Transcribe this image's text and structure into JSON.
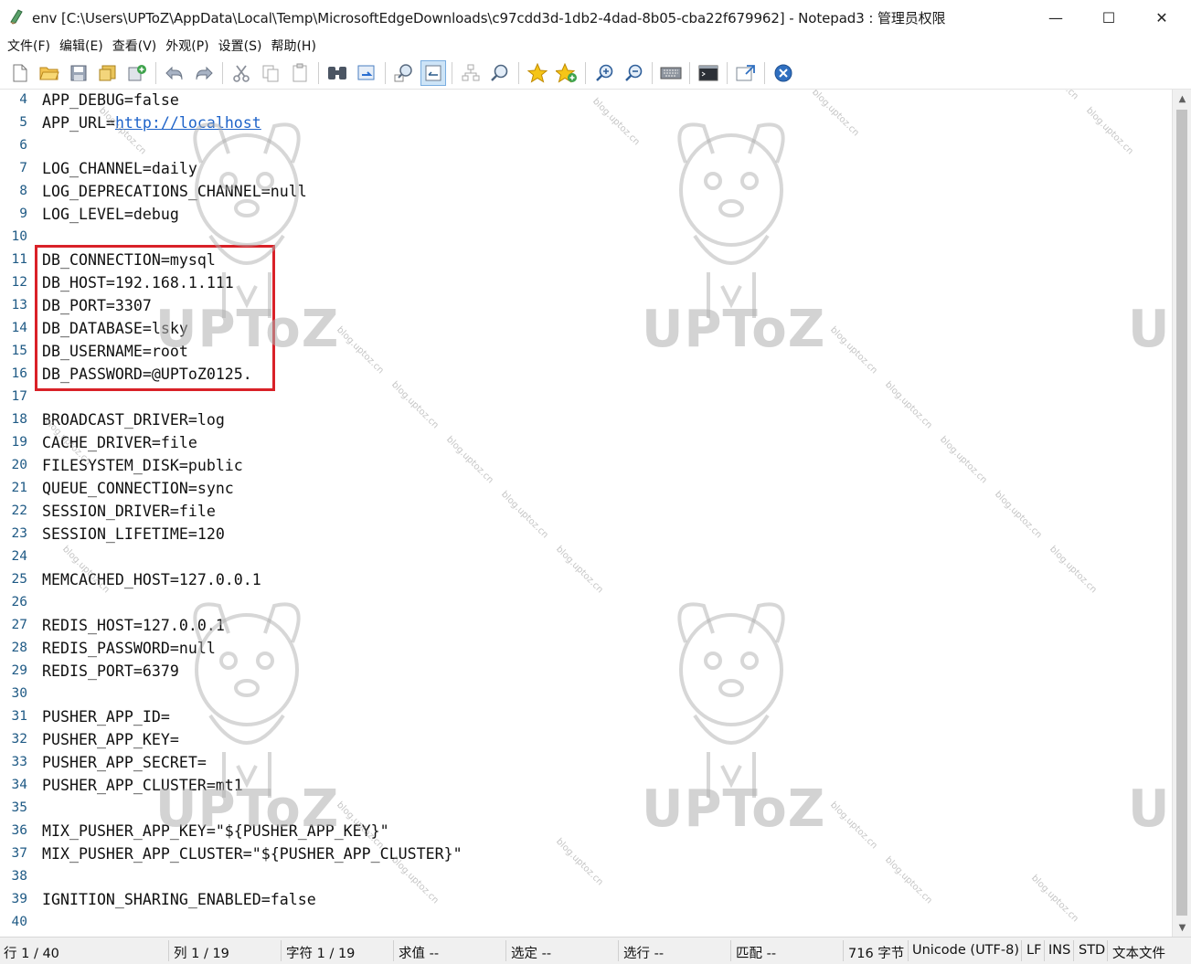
{
  "window": {
    "title": "env [C:\\Users\\UPToZ\\AppData\\Local\\Temp\\MicrosoftEdgeDownloads\\c97cdd3d-1db2-4dad-8b05-cba22f679962] - Notepad3 : 管理员权限",
    "minimize_glyph": "—",
    "maximize_glyph": "☐",
    "close_glyph": "✕"
  },
  "menu": [
    "文件(F)",
    "编辑(E)",
    "查看(V)",
    "外观(P)",
    "设置(S)",
    "帮助(H)"
  ],
  "toolbar": {
    "icons": [
      "new-file-icon",
      "open-folder-icon",
      "save-icon",
      "save-as-icon",
      "save-copy-icon",
      "sep",
      "undo-icon",
      "redo-icon",
      "sep",
      "cut-icon",
      "copy-icon",
      "paste-icon",
      "sep",
      "find-icon",
      "replace-icon",
      "sep",
      "zoom-find-icon",
      "word-wrap-icon",
      "sep",
      "tree-icon",
      "search-icon",
      "sep",
      "favorite-icon",
      "add-favorite-icon",
      "sep",
      "zoom-in-icon",
      "zoom-out-icon",
      "sep",
      "keyboard-icon",
      "sep",
      "terminal-icon",
      "sep",
      "pin-icon",
      "sep",
      "close-circle-icon"
    ]
  },
  "editor": {
    "lines": [
      {
        "n": "4",
        "text": "APP_DEBUG=false"
      },
      {
        "n": "5",
        "text": "APP_URL=",
        "url": "http://localhost"
      },
      {
        "n": "6",
        "text": ""
      },
      {
        "n": "7",
        "text": "LOG_CHANNEL=daily"
      },
      {
        "n": "8",
        "text": "LOG_DEPRECATIONS_CHANNEL=null"
      },
      {
        "n": "9",
        "text": "LOG_LEVEL=debug"
      },
      {
        "n": "10",
        "text": ""
      },
      {
        "n": "11",
        "text": "DB_CONNECTION=mysql"
      },
      {
        "n": "12",
        "text": "DB_HOST=192.168.1.111"
      },
      {
        "n": "13",
        "text": "DB_PORT=3307"
      },
      {
        "n": "14",
        "text": "DB_DATABASE=lsky"
      },
      {
        "n": "15",
        "text": "DB_USERNAME=root"
      },
      {
        "n": "16",
        "text": "DB_PASSWORD=@UPToZ0125."
      },
      {
        "n": "17",
        "text": ""
      },
      {
        "n": "18",
        "text": "BROADCAST_DRIVER=log"
      },
      {
        "n": "19",
        "text": "CACHE_DRIVER=file"
      },
      {
        "n": "20",
        "text": "FILESYSTEM_DISK=public"
      },
      {
        "n": "21",
        "text": "QUEUE_CONNECTION=sync"
      },
      {
        "n": "22",
        "text": "SESSION_DRIVER=file"
      },
      {
        "n": "23",
        "text": "SESSION_LIFETIME=120"
      },
      {
        "n": "24",
        "text": ""
      },
      {
        "n": "25",
        "text": "MEMCACHED_HOST=127.0.0.1"
      },
      {
        "n": "26",
        "text": ""
      },
      {
        "n": "27",
        "text": "REDIS_HOST=127.0.0.1"
      },
      {
        "n": "28",
        "text": "REDIS_PASSWORD=null"
      },
      {
        "n": "29",
        "text": "REDIS_PORT=6379"
      },
      {
        "n": "30",
        "text": ""
      },
      {
        "n": "31",
        "text": "PUSHER_APP_ID="
      },
      {
        "n": "32",
        "text": "PUSHER_APP_KEY="
      },
      {
        "n": "33",
        "text": "PUSHER_APP_SECRET="
      },
      {
        "n": "34",
        "text": "PUSHER_APP_CLUSTER=mt1"
      },
      {
        "n": "35",
        "text": ""
      },
      {
        "n": "36",
        "text": "MIX_PUSHER_APP_KEY=\"${PUSHER_APP_KEY}\""
      },
      {
        "n": "37",
        "text": "MIX_PUSHER_APP_CLUSTER=\"${PUSHER_APP_CLUSTER}\""
      },
      {
        "n": "38",
        "text": ""
      },
      {
        "n": "39",
        "text": "IGNITION_SHARING_ENABLED=false"
      },
      {
        "n": "40",
        "text": ""
      }
    ],
    "highlight_color": "#d92128"
  },
  "statusbar": {
    "line": "行 1 / 40",
    "column": "列 1 / 19",
    "char": "字符 1 / 19",
    "eval": "求值 --",
    "selection": "选定 --",
    "sel_lines": "选行 --",
    "match": "匹配 --",
    "bytes": "716 字节",
    "encoding": "Unicode (UTF-8)",
    "eol": "LF",
    "ins": "INS",
    "std": "STD",
    "filetype": "文本文件"
  },
  "watermark": {
    "logo": "UPToZ",
    "site": "blog.uptoz.cn"
  },
  "colors": {
    "line_number": "#1f5a85",
    "url": "#1e63c9",
    "statusbar_bg": "#f0f0f0"
  }
}
